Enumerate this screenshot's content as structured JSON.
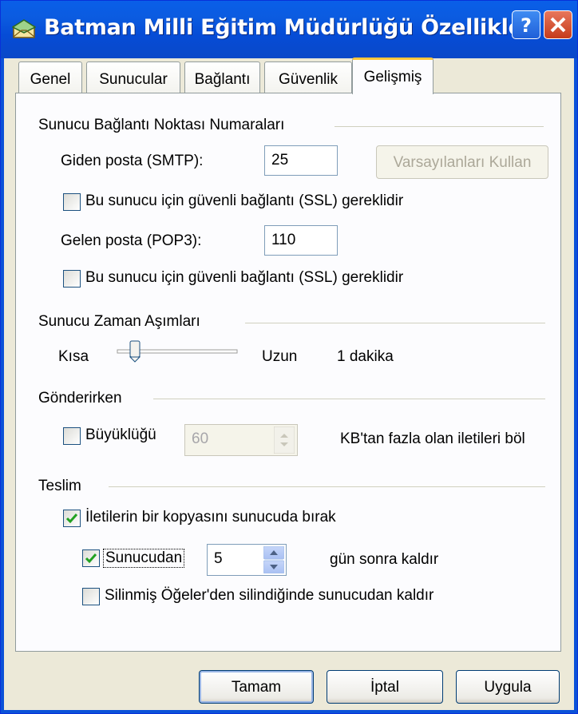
{
  "window": {
    "title": "Batman Milli Eğitim Müdürlüğü Özellikleri"
  },
  "tabs": [
    {
      "label": "Genel"
    },
    {
      "label": "Sunucular"
    },
    {
      "label": "Bağlantı"
    },
    {
      "label": "Güvenlik"
    },
    {
      "label": "Gelişmiş"
    }
  ],
  "ports": {
    "group_label": "Sunucu Bağlantı Noktası Numaraları",
    "smtp_label": "Giden posta (SMTP):",
    "smtp_value": "25",
    "defaults_button": "Varsayılanları Kullan",
    "smtp_ssl_label": "Bu sunucu için güvenli bağlantı (SSL) gereklidir",
    "smtp_ssl_checked": false,
    "pop3_label": "Gelen posta (POP3):",
    "pop3_value": "110",
    "pop3_ssl_label": "Bu sunucu için güvenli bağlantı (SSL) gereklidir",
    "pop3_ssl_checked": false
  },
  "timeouts": {
    "group_label": "Sunucu Zaman Aşımları",
    "short_label": "Kısa",
    "long_label": "Uzun",
    "value_label": "1 dakika"
  },
  "sending": {
    "group_label": "Gönderirken",
    "split_label": "Büyüklüğü",
    "split_checked": false,
    "split_value": "60",
    "split_suffix": "KB'tan fazla olan iletileri böl"
  },
  "delivery": {
    "group_label": "Teslim",
    "leave_copy_label": "İletilerin bir kopyasını sunucuda bırak",
    "leave_copy_checked": true,
    "remove_after_label": "Sunucudan",
    "remove_after_checked": true,
    "remove_after_value": "5",
    "remove_after_suffix": "gün sonra kaldır",
    "remove_deleted_label": "Silinmiş Öğeler'den silindiğinde sunucudan kaldır",
    "remove_deleted_checked": false
  },
  "buttons": {
    "ok": "Tamam",
    "cancel": "İptal",
    "apply": "Uygula"
  }
}
